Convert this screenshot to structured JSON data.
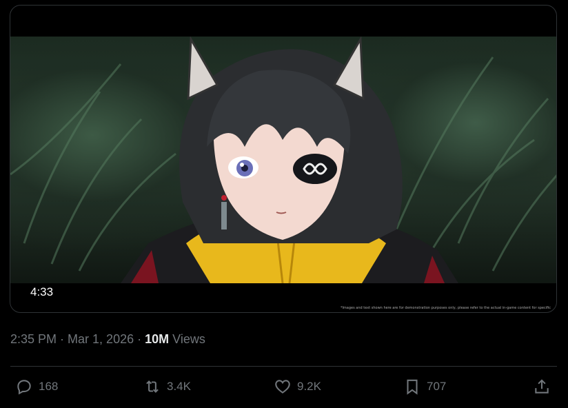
{
  "media": {
    "duration": "4:33",
    "disclaimer": "*Images and text shown here are for demonstration purposes only, please refer to the actual in-game content for specific"
  },
  "meta": {
    "time": "2:35 PM",
    "separator1": " · ",
    "date": "Mar 1, 2026",
    "separator2": " · ",
    "views_count": "10M",
    "views_label": "Views"
  },
  "actions": {
    "replies": "168",
    "reposts": "3.4K",
    "likes": "9.2K",
    "bookmarks": "707"
  },
  "icons": [
    "reply-icon",
    "repost-icon",
    "like-icon",
    "bookmark-icon",
    "share-icon"
  ]
}
